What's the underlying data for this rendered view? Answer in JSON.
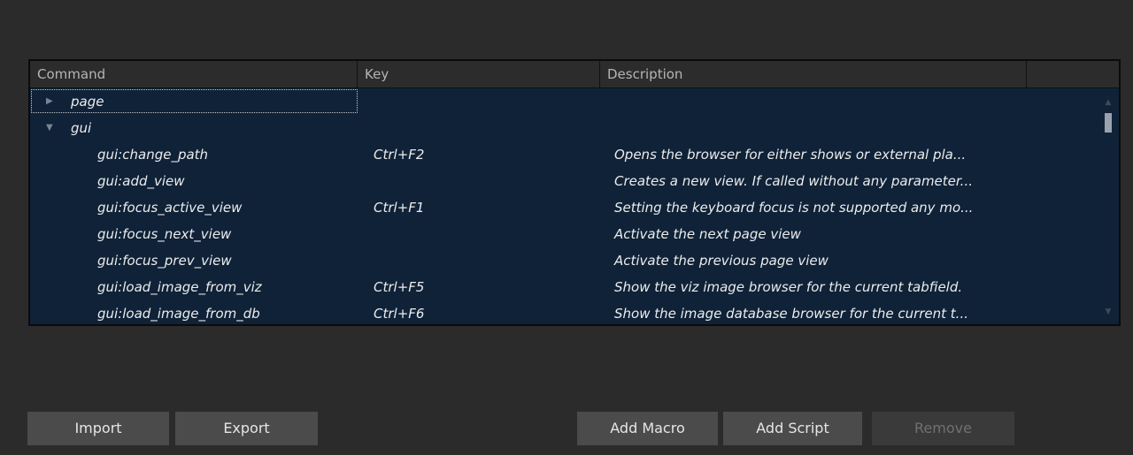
{
  "table": {
    "columns": [
      "Command",
      "Key",
      "Description",
      ""
    ],
    "rows": [
      {
        "command": "page",
        "key": "",
        "description": "",
        "type": "group",
        "expanded": false
      },
      {
        "command": "gui",
        "key": "",
        "description": "",
        "type": "group",
        "expanded": true
      },
      {
        "command": "gui:change_path",
        "key": "Ctrl+F2",
        "description": "Opens the browser for either shows or external pla...",
        "type": "item"
      },
      {
        "command": "gui:add_view",
        "key": "",
        "description": "Creates a new view. If called without any parameter...",
        "type": "item"
      },
      {
        "command": "gui:focus_active_view",
        "key": "Ctrl+F1",
        "description": "Setting the keyboard focus is not supported any mo...",
        "type": "item"
      },
      {
        "command": "gui:focus_next_view",
        "key": "",
        "description": "Activate the next page view",
        "type": "item"
      },
      {
        "command": "gui:focus_prev_view",
        "key": "",
        "description": "Activate the previous page view",
        "type": "item"
      },
      {
        "command": "gui:load_image_from_viz",
        "key": "Ctrl+F5",
        "description": "Show the viz image browser for the current tabfield.",
        "type": "item"
      },
      {
        "command": "gui:load_image_from_db",
        "key": "Ctrl+F6",
        "description": "Show the image database browser for the current t...",
        "type": "item"
      }
    ]
  },
  "icons": {
    "collapsed": "triangle-right-icon",
    "expanded": "triangle-down-icon",
    "scroll_up": "scroll-up-arrow-icon",
    "scroll_down": "scroll-down-arrow-icon"
  },
  "buttons": {
    "import": "Import",
    "export": "Export",
    "add_macro": "Add Macro",
    "add_script": "Add Script",
    "remove": "Remove"
  },
  "colors": {
    "background": "#2b2b2b",
    "table_bg": "#0f2238",
    "header_bg": "#2c2c2c",
    "button_bg": "#4b4b4b",
    "button_disabled_bg": "#3a3a3a"
  }
}
